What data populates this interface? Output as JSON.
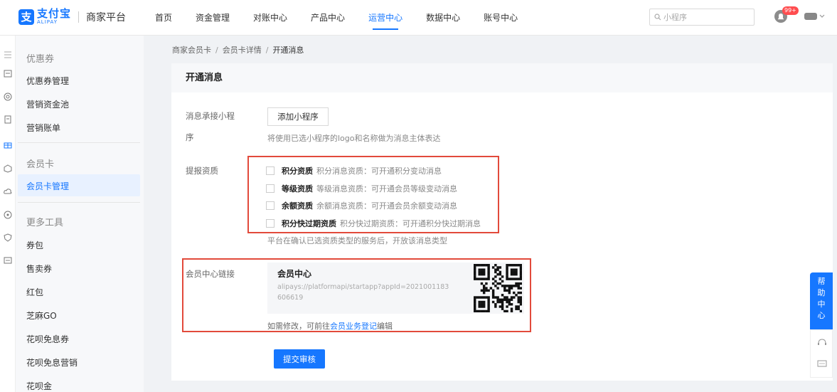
{
  "header": {
    "logo_mark": "支",
    "logo_title": "支付宝",
    "logo_en": "ALIPAY",
    "platform_name": "商家平台",
    "nav": [
      {
        "label": "首页",
        "active": false
      },
      {
        "label": "资金管理",
        "active": false
      },
      {
        "label": "对账中心",
        "active": false
      },
      {
        "label": "产品中心",
        "active": false
      },
      {
        "label": "运营中心",
        "active": true
      },
      {
        "label": "数据中心",
        "active": false
      },
      {
        "label": "账号中心",
        "active": false
      }
    ],
    "search_placeholder": "小程序",
    "notification_badge": "99+",
    "accent_color": "#1677ff"
  },
  "sidebar": {
    "group1": "优惠券",
    "items1": [
      "优惠券管理",
      "营销资金池",
      "营销账单"
    ],
    "group2": "会员卡",
    "items2": [
      "会员卡管理"
    ],
    "group3": "更多工具",
    "items3": [
      "券包",
      "售卖券",
      "红包",
      "芝麻GO",
      "花呗免息券",
      "花呗免息营销",
      "花呗金"
    ]
  },
  "breadcrumb": [
    "商家会员卡",
    "会员卡详情",
    "开通消息"
  ],
  "card": {
    "title": "开通消息",
    "miniapp": {
      "label_line1": "消息承接小程",
      "label_line2": "序",
      "button": "添加小程序",
      "hint": "将使用已选小程序的logo和名称做为消息主体表达"
    },
    "qualification": {
      "label": "提报资质",
      "options": [
        {
          "name": "积分资质",
          "desc": "积分消息资质：可开通积分变动消息"
        },
        {
          "name": "等级资质",
          "desc": "等级消息资质：可开通会员等级变动消息"
        },
        {
          "name": "余额资质",
          "desc": "余额消息资质：可开通会员余额变动消息"
        },
        {
          "name": "积分快过期资质",
          "desc": "积分快过期资质：可开通积分快过期消息"
        }
      ],
      "hint": "平台在确认已选资质类型的服务后，开放该消息类型"
    },
    "member_link": {
      "label": "会员中心链接",
      "title": "会员中心",
      "url": "alipays://platformapi/startapp?appId=2021001183606619",
      "hint_prefix": "如需修改，可前往",
      "hint_link": "会员业务登记",
      "hint_suffix": "编辑"
    },
    "submit": "提交审核"
  },
  "help": {
    "label": "帮助中心"
  }
}
